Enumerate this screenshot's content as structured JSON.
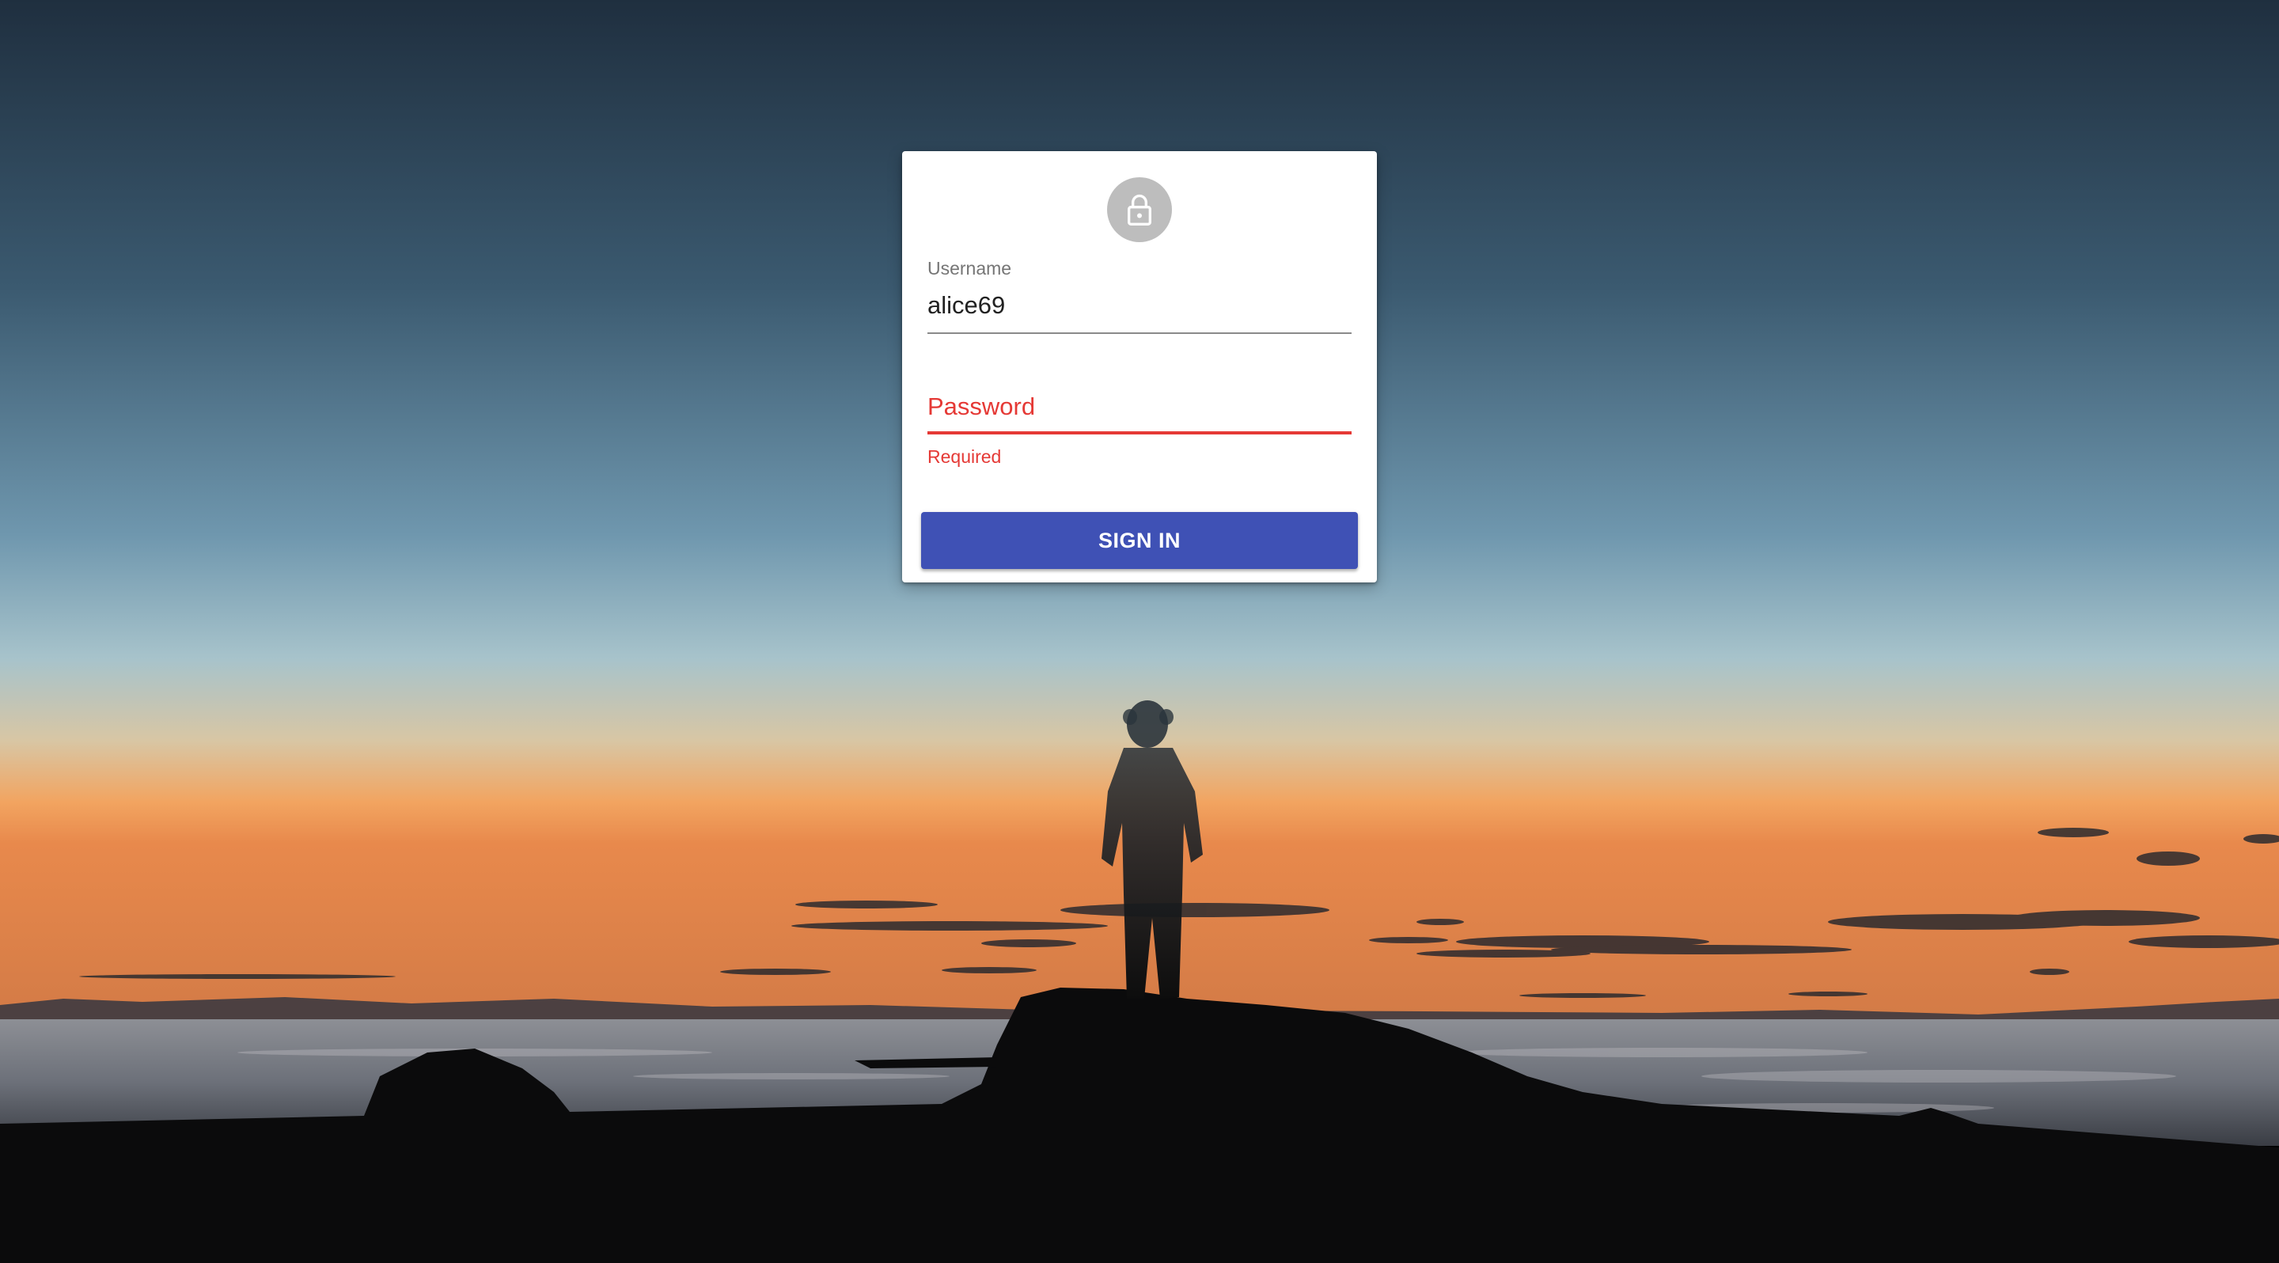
{
  "colors": {
    "sky_top": "#233445",
    "sky_mid": "#5f8aa3",
    "sky_low": "#a9c3cc",
    "horizon_glow": "#f09a5a",
    "silhouette": "#0a0a0a",
    "error": "#e53935",
    "primary": "#3f51b5",
    "avatar_bg": "#bdbdbd"
  },
  "login": {
    "icon": "lock-icon",
    "username": {
      "label": "Username",
      "value": "alice69"
    },
    "password": {
      "label": "Password",
      "helper_text": "Required"
    },
    "sign_in_label": "SIGN IN"
  }
}
